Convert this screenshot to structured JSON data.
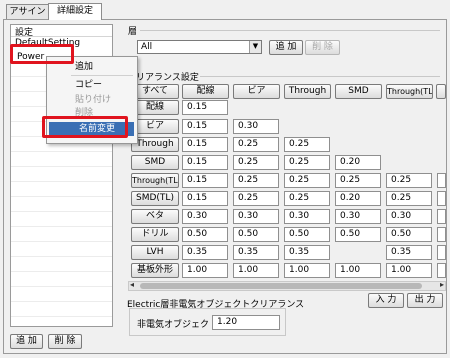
{
  "tabs": [
    "アサイン",
    "詳細設定"
  ],
  "sidebar": {
    "header": "設定",
    "items": [
      "DefaultSetting",
      "Power"
    ],
    "add_label": "追 加",
    "delete_label": "削 除"
  },
  "context_menu": {
    "items": [
      "追加",
      "コピー",
      "貼り付け",
      "削除",
      "名前変更"
    ]
  },
  "layer": {
    "group_title": "層",
    "selected": "All",
    "add_label": "追 加",
    "delete_label": "削 除"
  },
  "clearance": {
    "group_title": "クリアランス設定",
    "columns": [
      "すべて",
      "配線",
      "ビア",
      "Through",
      "SMD",
      "Through(TL)"
    ],
    "rows": [
      {
        "label": "配線",
        "values": [
          "0.15"
        ]
      },
      {
        "label": "ビア",
        "values": [
          "0.15",
          "0.30"
        ]
      },
      {
        "label": "Through",
        "values": [
          "0.15",
          "0.25",
          "0.25"
        ]
      },
      {
        "label": "SMD",
        "values": [
          "0.15",
          "0.25",
          "0.25",
          "0.20"
        ]
      },
      {
        "label": "Through(TL)",
        "values": [
          "0.15",
          "0.25",
          "0.25",
          "0.25",
          "0.25"
        ]
      },
      {
        "label": "SMD(TL)",
        "values": [
          "0.15",
          "0.25",
          "0.25",
          "0.20",
          "0.25"
        ]
      },
      {
        "label": "ベタ",
        "values": [
          "0.30",
          "0.30",
          "0.30",
          "0.30",
          "0.30"
        ]
      },
      {
        "label": "ドリル",
        "values": [
          "0.50",
          "0.50",
          "0.50",
          "0.50",
          "0.50"
        ]
      },
      {
        "label": "LVH",
        "values": [
          "0.35",
          "0.35",
          "0.35",
          "",
          "0.35"
        ]
      },
      {
        "label": "基板外形",
        "values": [
          "1.00",
          "1.00",
          "1.00",
          "1.00",
          "1.00"
        ]
      }
    ],
    "input_label": "入 力",
    "output_label": "出 力"
  },
  "electric": {
    "group_title": "Electric層非電気オブジェクトクリアランス",
    "label": "非電気オブジェクト",
    "value": "1.20"
  },
  "colors": {
    "highlight_outline": "#e0141e",
    "menu_selection": "#3a6fb4"
  }
}
